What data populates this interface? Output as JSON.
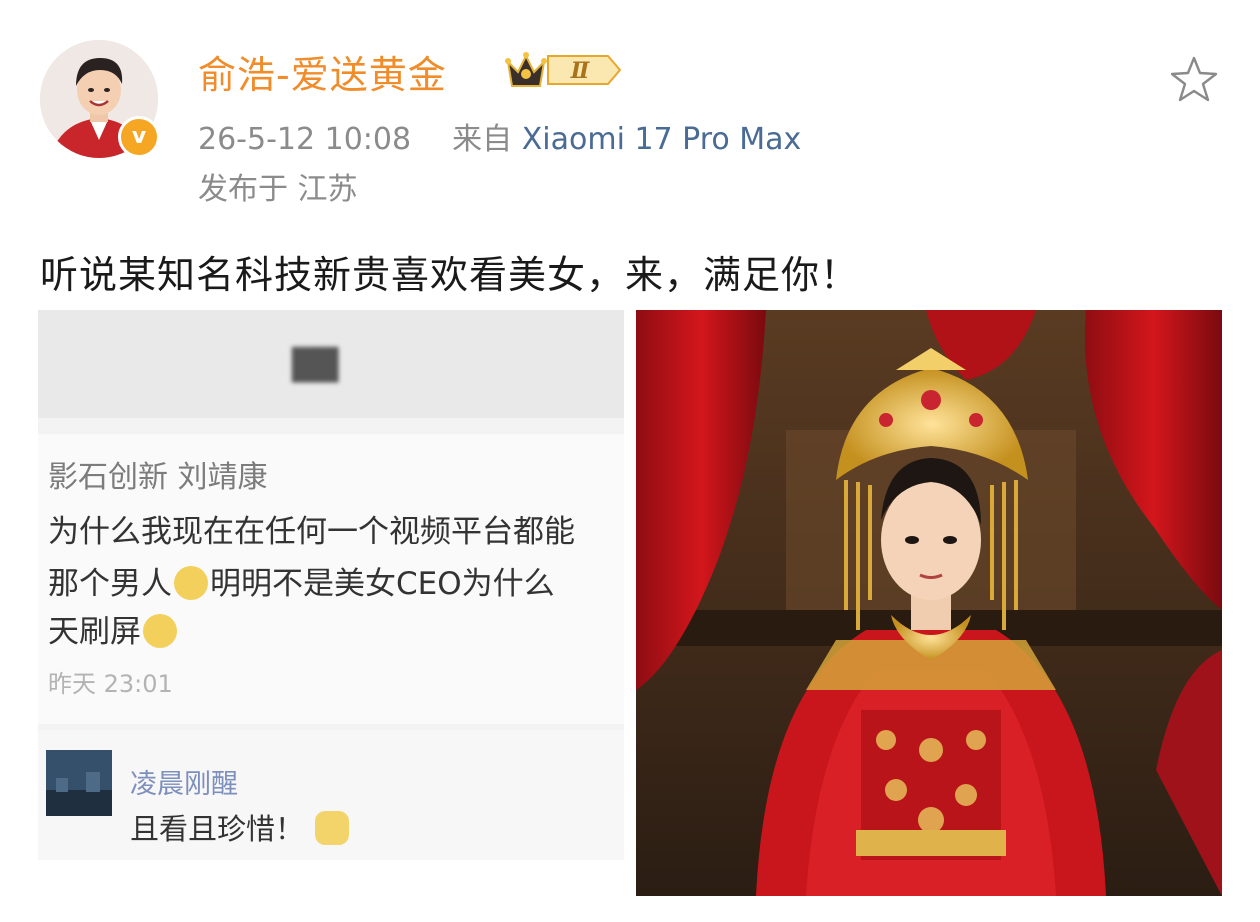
{
  "header": {
    "username": "俞浩-爱送黄金",
    "badge_level": "Ⅱ",
    "timestamp": "26-5-12 10:08",
    "source_prefix": "来自",
    "device": "Xiaomi 17 Pro Max",
    "location": "发布于 江苏",
    "verified_mark": "v"
  },
  "post": {
    "text": "听说某知名科技新贵喜欢看美女，来，满足你！"
  },
  "screenshot": {
    "blurred_title": "██",
    "comment_author": "影石创新 刘靖康",
    "comment_line1": "为什么我现在在任何一个视频平台都能",
    "comment_line2a": "那个男人",
    "comment_line2b": "明明不是美女CEO为什么",
    "comment_line3": "天刷屏",
    "comment_time": "昨天 23:01",
    "reply_author": "凌晨刚醒",
    "reply_text": "且看且珍惜！"
  },
  "icons": {
    "star": "star-outline-icon",
    "crown": "crown-icon",
    "verified": "verified-badge-icon"
  },
  "colors": {
    "username": "#f08c2a",
    "device_link": "#4a6b94",
    "meta_text": "#8b8b8b",
    "verified": "#f5a623"
  }
}
